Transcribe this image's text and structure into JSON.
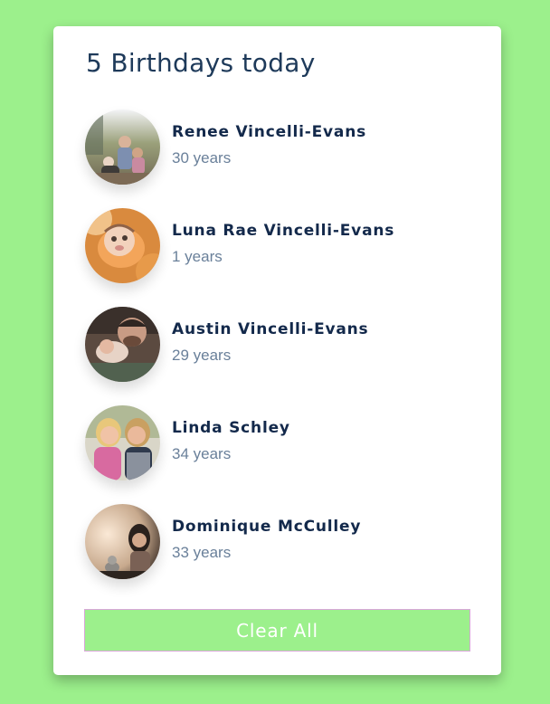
{
  "title": "5 Birthdays today",
  "people": [
    {
      "name": "Renee Vincelli-Evans",
      "age": "30 years",
      "avatar_icon": "family-photo-avatar"
    },
    {
      "name": "Luna Rae Vincelli-Evans",
      "age": "1 years",
      "avatar_icon": "baby-photo-avatar"
    },
    {
      "name": "Austin Vincelli-Evans",
      "age": "29 years",
      "avatar_icon": "father-baby-photo-avatar"
    },
    {
      "name": "Linda Schley",
      "age": "34 years",
      "avatar_icon": "two-women-photo-avatar"
    },
    {
      "name": "Dominique McCulley",
      "age": "33 years",
      "avatar_icon": "woman-portrait-photo-avatar"
    }
  ],
  "clear_button_label": "Clear All",
  "colors": {
    "background": "#9cf08c",
    "card": "#ffffff",
    "name_text": "#13294b",
    "age_text": "#6a809a",
    "button": "#9cf08c",
    "button_text": "#ffffff"
  }
}
